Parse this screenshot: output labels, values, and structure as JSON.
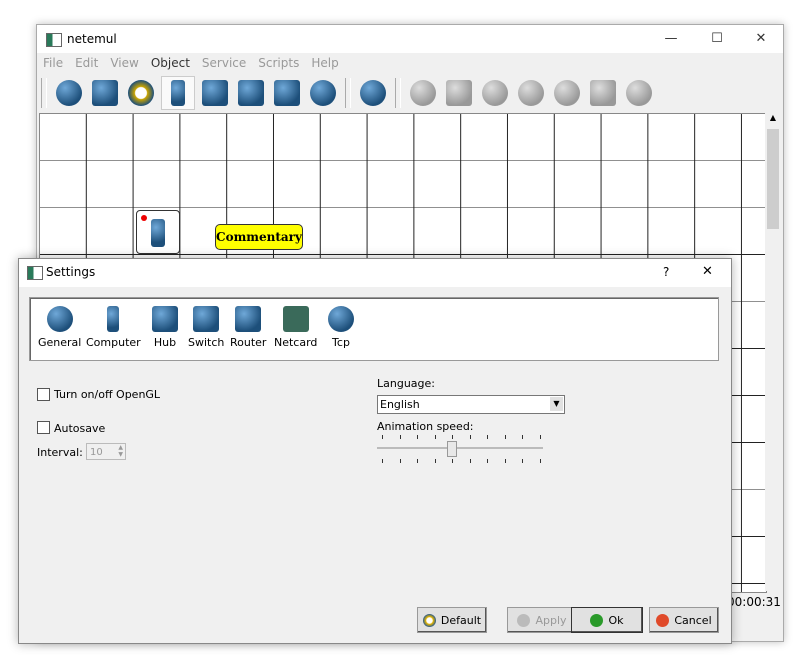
{
  "app": {
    "title": "netemul",
    "menu": [
      "File",
      "Edit",
      "View",
      "Object",
      "Service",
      "Scripts",
      "Help"
    ],
    "active_menu": "Object",
    "toolbar": [
      "select-icon",
      "note-icon",
      "cable-icon",
      "computer-icon",
      "hub-icon",
      "switch-icon",
      "router-icon",
      "move-icon",
      "pause-icon",
      "settings-icon",
      "netcard-icon",
      "printer-icon",
      "router-table-icon",
      "arp-icon",
      "program-icon",
      "gear-icon"
    ],
    "canvas": {
      "commentary": "Commentary"
    },
    "status_time": "00:00:31"
  },
  "settings": {
    "title": "Settings",
    "help": "?",
    "close": "✕",
    "pages": [
      "General",
      "Computer",
      "Hub",
      "Switch",
      "Router",
      "Netcard",
      "Tcp"
    ],
    "opengl_label": "Turn on/off OpenGL",
    "opengl_checked": false,
    "autosave_label": "Autosave",
    "autosave_checked": false,
    "interval_label": "Interval:",
    "interval_value": "10",
    "language_label": "Language:",
    "language_value": "English",
    "anim_label": "Animation speed:",
    "anim_speed_fraction": 0.44,
    "buttons": {
      "default": "Default",
      "apply": "Apply",
      "ok": "Ok",
      "cancel": "Cancel"
    }
  }
}
